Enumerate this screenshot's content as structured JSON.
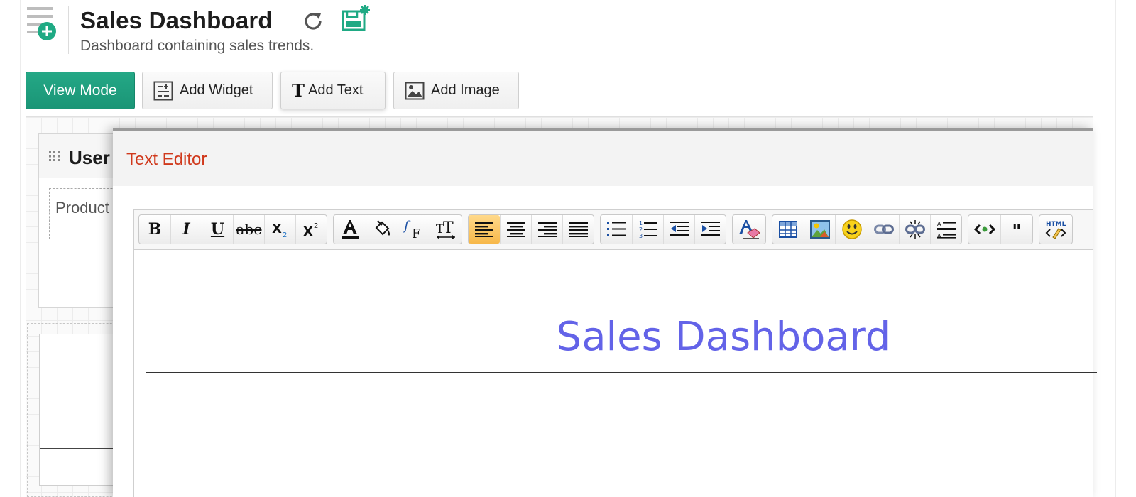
{
  "header": {
    "title": "Sales Dashboard",
    "subtitle": "Dashboard containing sales trends."
  },
  "toolbar": {
    "view_mode": "View Mode",
    "add_widget": "Add Widget",
    "add_text": "Add Text",
    "add_image": "Add Image"
  },
  "widgets": {
    "w1_title": "User",
    "w1_label": "Product"
  },
  "editor": {
    "title": "Text Editor",
    "heading_text": "Sales Dashboard",
    "active_tool": "align-left"
  },
  "icons": {
    "menu": "add-menu-icon",
    "refresh": "refresh-icon",
    "save": "save-new-icon"
  },
  "colors": {
    "accent": "#1a9576",
    "editor_title": "#d0391c",
    "heading": "#6363e8"
  }
}
